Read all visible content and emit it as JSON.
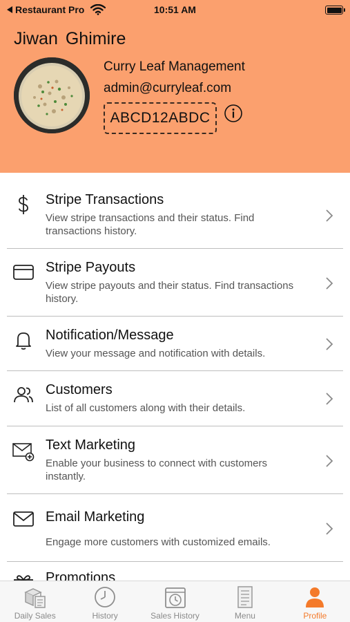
{
  "status_bar": {
    "carrier": "Restaurant Pro",
    "time": "10:51 AM"
  },
  "profile": {
    "name": "Jiwan  Ghimire",
    "business_name": "Curry Leaf Management",
    "email": "admin@curryleaf.com",
    "code": "ABCD12ABDC"
  },
  "menu": {
    "items": [
      {
        "title": "Stripe Transactions",
        "desc": "View stripe transactions and their status. Find transactions history.",
        "icon": "dollar-icon"
      },
      {
        "title": "Stripe Payouts",
        "desc": "View stripe payouts and their status. Find transactions history.",
        "icon": "card-icon"
      },
      {
        "title": "Notification/Message",
        "desc": "View your message and notification with details.",
        "icon": "bell-icon"
      },
      {
        "title": "Customers",
        "desc": "List of all customers along with their details.",
        "icon": "users-icon"
      },
      {
        "title": "Text Marketing",
        "desc": "Enable your business to connect with customers instantly.",
        "icon": "mail-plus-icon"
      },
      {
        "title": "Email Marketing",
        "desc": "Engage more customers with customized emails.",
        "icon": "envelope-icon"
      },
      {
        "title": "Promotions",
        "desc": "",
        "icon": "gift-icon"
      }
    ]
  },
  "tabbar": {
    "tabs": [
      {
        "label": "Daily Sales",
        "icon": "boxes-icon"
      },
      {
        "label": "History",
        "icon": "clock-icon"
      },
      {
        "label": "Sales History",
        "icon": "calendar-clock-icon"
      },
      {
        "label": "Menu",
        "icon": "menu-list-icon"
      },
      {
        "label": "Profile",
        "icon": "person-icon"
      }
    ],
    "active_index": 4
  },
  "colors": {
    "header_bg": "#fba06e",
    "active_tab": "#f47a2a"
  }
}
